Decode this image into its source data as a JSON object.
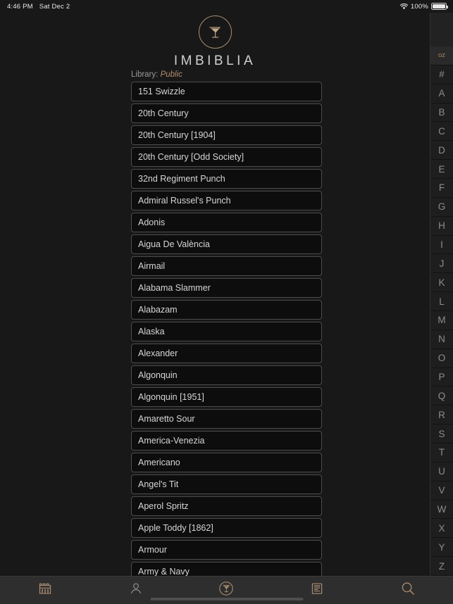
{
  "status_bar": {
    "time": "4:46 PM",
    "date": "Sat Dec 2",
    "battery_percent": "100%",
    "wifi_icon": "wifi-icon",
    "battery_icon": "battery-icon"
  },
  "header": {
    "app_title": "IMBIBLIA",
    "logo_icon": "cocktail-glass-logo-icon"
  },
  "library": {
    "label": "Library:",
    "value": "Public"
  },
  "colors": {
    "accent": "#b08e6e",
    "background": "#181818",
    "row_border": "#4c4c4c",
    "text": "#d6d6d6",
    "index_background": "#1e1e1e",
    "tabbar_background": "#2e2e2e"
  },
  "drink_list": [
    "151 Swizzle",
    "20th Century",
    "20th Century [1904]",
    "20th Century [Odd Society]",
    "32nd Regiment Punch",
    "Admiral Russel's Punch",
    "Adonis",
    "Aigua De València",
    "Airmail",
    "Alabama Slammer",
    "Alabazam",
    "Alaska",
    "Alexander",
    "Algonquin",
    "Algonquin [1951]",
    "Amaretto Sour",
    "America-Venezia",
    "Americano",
    "Angel's Tit",
    "Aperol Spritz",
    "Apple Toddy [1862]",
    "Armour",
    "Army & Navy"
  ],
  "index": {
    "unit_toggle": "oz",
    "letters": [
      "#",
      "A",
      "B",
      "C",
      "D",
      "E",
      "F",
      "G",
      "H",
      "I",
      "J",
      "K",
      "L",
      "M",
      "N",
      "O",
      "P",
      "Q",
      "R",
      "S",
      "T",
      "U",
      "V",
      "W",
      "X",
      "Y",
      "Z"
    ]
  },
  "tabbar": {
    "items": [
      {
        "icon": "bar-cabinet-icon",
        "name": "tab-bar-shelf"
      },
      {
        "icon": "person-icon",
        "name": "tab-profile"
      },
      {
        "icon": "cocktail-glass-circle-icon",
        "name": "tab-drinks"
      },
      {
        "icon": "list-document-icon",
        "name": "tab-recipes"
      },
      {
        "icon": "search-icon",
        "name": "tab-search"
      }
    ]
  }
}
